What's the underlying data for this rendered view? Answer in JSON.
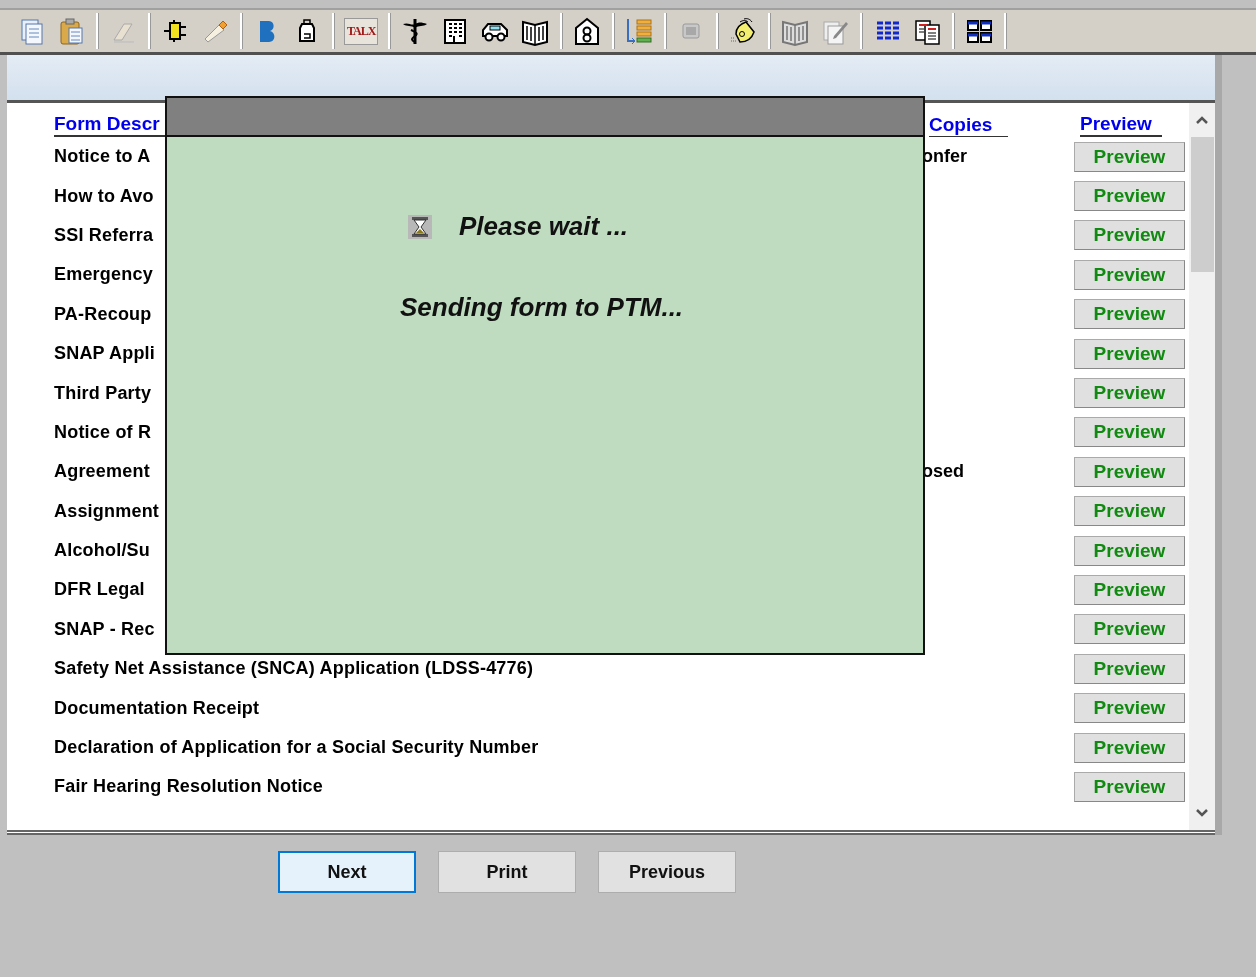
{
  "toolbar": {
    "badge_text": "TALX"
  },
  "table": {
    "columns": [
      {
        "label": "Form Descr"
      },
      {
        "label": "Copies"
      },
      {
        "label": "Preview"
      }
    ],
    "rows": [
      {
        "description": "Notice to A",
        "continuation": "onfer",
        "button": "Preview"
      },
      {
        "description": "How to Avo",
        "button": "Preview"
      },
      {
        "description": "SSI Referra",
        "button": "Preview"
      },
      {
        "description": "Emergency",
        "button": "Preview"
      },
      {
        "description": "PA-Recoup",
        "button": "Preview"
      },
      {
        "description": "SNAP Appli",
        "button": "Preview"
      },
      {
        "description": "Third Party",
        "button": "Preview"
      },
      {
        "description": "Notice of R",
        "button": "Preview"
      },
      {
        "description": "Agreement",
        "continuation": "osed",
        "button": "Preview"
      },
      {
        "description": "Assignment",
        "button": "Preview"
      },
      {
        "description": "Alcohol/Su",
        "button": "Preview"
      },
      {
        "description": "DFR Legal",
        "button": "Preview"
      },
      {
        "description": "SNAP - Rec",
        "button": "Preview"
      },
      {
        "description": "Safety Net Assistance (SNCA) Application (LDSS-4776)",
        "button": "Preview"
      },
      {
        "description": "Documentation Receipt",
        "button": "Preview"
      },
      {
        "description": "Declaration of Application for a Social Security Number",
        "button": "Preview"
      },
      {
        "description": "Fair Hearing Resolution Notice",
        "button": "Preview"
      }
    ]
  },
  "buttons": [
    {
      "label": "Next",
      "selected": true
    },
    {
      "label": "Print",
      "selected": false
    },
    {
      "label": "Previous",
      "selected": false
    }
  ],
  "dialog": {
    "title": "Please wait ...",
    "message": "Sending form to PTM..."
  }
}
